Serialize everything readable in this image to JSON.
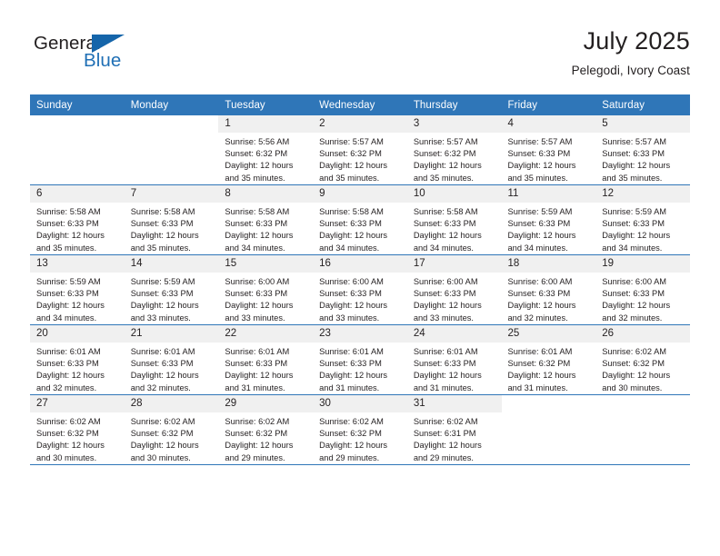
{
  "logo": {
    "word1": "General",
    "word2": "Blue",
    "triangle_color": "#1565aa",
    "blue_text_color": "#1f6fb5"
  },
  "header": {
    "title": "July 2025",
    "subtitle": "Pelegodi, Ivory Coast"
  },
  "theme": {
    "header_blue": "#2f76b8",
    "daynum_strip": "#f0f0f0",
    "text": "#231f20"
  },
  "weekdays": [
    "Sunday",
    "Monday",
    "Tuesday",
    "Wednesday",
    "Thursday",
    "Friday",
    "Saturday"
  ],
  "weeks": [
    [
      {
        "day": "",
        "blank": true
      },
      {
        "day": "",
        "blank": true
      },
      {
        "day": "1",
        "sunrise": "Sunrise: 5:56 AM",
        "sunset": "Sunset: 6:32 PM",
        "daylight1": "Daylight: 12 hours",
        "daylight2": "and 35 minutes."
      },
      {
        "day": "2",
        "sunrise": "Sunrise: 5:57 AM",
        "sunset": "Sunset: 6:32 PM",
        "daylight1": "Daylight: 12 hours",
        "daylight2": "and 35 minutes."
      },
      {
        "day": "3",
        "sunrise": "Sunrise: 5:57 AM",
        "sunset": "Sunset: 6:32 PM",
        "daylight1": "Daylight: 12 hours",
        "daylight2": "and 35 minutes."
      },
      {
        "day": "4",
        "sunrise": "Sunrise: 5:57 AM",
        "sunset": "Sunset: 6:33 PM",
        "daylight1": "Daylight: 12 hours",
        "daylight2": "and 35 minutes."
      },
      {
        "day": "5",
        "sunrise": "Sunrise: 5:57 AM",
        "sunset": "Sunset: 6:33 PM",
        "daylight1": "Daylight: 12 hours",
        "daylight2": "and 35 minutes."
      }
    ],
    [
      {
        "day": "6",
        "sunrise": "Sunrise: 5:58 AM",
        "sunset": "Sunset: 6:33 PM",
        "daylight1": "Daylight: 12 hours",
        "daylight2": "and 35 minutes."
      },
      {
        "day": "7",
        "sunrise": "Sunrise: 5:58 AM",
        "sunset": "Sunset: 6:33 PM",
        "daylight1": "Daylight: 12 hours",
        "daylight2": "and 35 minutes."
      },
      {
        "day": "8",
        "sunrise": "Sunrise: 5:58 AM",
        "sunset": "Sunset: 6:33 PM",
        "daylight1": "Daylight: 12 hours",
        "daylight2": "and 34 minutes."
      },
      {
        "day": "9",
        "sunrise": "Sunrise: 5:58 AM",
        "sunset": "Sunset: 6:33 PM",
        "daylight1": "Daylight: 12 hours",
        "daylight2": "and 34 minutes."
      },
      {
        "day": "10",
        "sunrise": "Sunrise: 5:58 AM",
        "sunset": "Sunset: 6:33 PM",
        "daylight1": "Daylight: 12 hours",
        "daylight2": "and 34 minutes."
      },
      {
        "day": "11",
        "sunrise": "Sunrise: 5:59 AM",
        "sunset": "Sunset: 6:33 PM",
        "daylight1": "Daylight: 12 hours",
        "daylight2": "and 34 minutes."
      },
      {
        "day": "12",
        "sunrise": "Sunrise: 5:59 AM",
        "sunset": "Sunset: 6:33 PM",
        "daylight1": "Daylight: 12 hours",
        "daylight2": "and 34 minutes."
      }
    ],
    [
      {
        "day": "13",
        "sunrise": "Sunrise: 5:59 AM",
        "sunset": "Sunset: 6:33 PM",
        "daylight1": "Daylight: 12 hours",
        "daylight2": "and 34 minutes."
      },
      {
        "day": "14",
        "sunrise": "Sunrise: 5:59 AM",
        "sunset": "Sunset: 6:33 PM",
        "daylight1": "Daylight: 12 hours",
        "daylight2": "and 33 minutes."
      },
      {
        "day": "15",
        "sunrise": "Sunrise: 6:00 AM",
        "sunset": "Sunset: 6:33 PM",
        "daylight1": "Daylight: 12 hours",
        "daylight2": "and 33 minutes."
      },
      {
        "day": "16",
        "sunrise": "Sunrise: 6:00 AM",
        "sunset": "Sunset: 6:33 PM",
        "daylight1": "Daylight: 12 hours",
        "daylight2": "and 33 minutes."
      },
      {
        "day": "17",
        "sunrise": "Sunrise: 6:00 AM",
        "sunset": "Sunset: 6:33 PM",
        "daylight1": "Daylight: 12 hours",
        "daylight2": "and 33 minutes."
      },
      {
        "day": "18",
        "sunrise": "Sunrise: 6:00 AM",
        "sunset": "Sunset: 6:33 PM",
        "daylight1": "Daylight: 12 hours",
        "daylight2": "and 32 minutes."
      },
      {
        "day": "19",
        "sunrise": "Sunrise: 6:00 AM",
        "sunset": "Sunset: 6:33 PM",
        "daylight1": "Daylight: 12 hours",
        "daylight2": "and 32 minutes."
      }
    ],
    [
      {
        "day": "20",
        "sunrise": "Sunrise: 6:01 AM",
        "sunset": "Sunset: 6:33 PM",
        "daylight1": "Daylight: 12 hours",
        "daylight2": "and 32 minutes."
      },
      {
        "day": "21",
        "sunrise": "Sunrise: 6:01 AM",
        "sunset": "Sunset: 6:33 PM",
        "daylight1": "Daylight: 12 hours",
        "daylight2": "and 32 minutes."
      },
      {
        "day": "22",
        "sunrise": "Sunrise: 6:01 AM",
        "sunset": "Sunset: 6:33 PM",
        "daylight1": "Daylight: 12 hours",
        "daylight2": "and 31 minutes."
      },
      {
        "day": "23",
        "sunrise": "Sunrise: 6:01 AM",
        "sunset": "Sunset: 6:33 PM",
        "daylight1": "Daylight: 12 hours",
        "daylight2": "and 31 minutes."
      },
      {
        "day": "24",
        "sunrise": "Sunrise: 6:01 AM",
        "sunset": "Sunset: 6:33 PM",
        "daylight1": "Daylight: 12 hours",
        "daylight2": "and 31 minutes."
      },
      {
        "day": "25",
        "sunrise": "Sunrise: 6:01 AM",
        "sunset": "Sunset: 6:32 PM",
        "daylight1": "Daylight: 12 hours",
        "daylight2": "and 31 minutes."
      },
      {
        "day": "26",
        "sunrise": "Sunrise: 6:02 AM",
        "sunset": "Sunset: 6:32 PM",
        "daylight1": "Daylight: 12 hours",
        "daylight2": "and 30 minutes."
      }
    ],
    [
      {
        "day": "27",
        "sunrise": "Sunrise: 6:02 AM",
        "sunset": "Sunset: 6:32 PM",
        "daylight1": "Daylight: 12 hours",
        "daylight2": "and 30 minutes."
      },
      {
        "day": "28",
        "sunrise": "Sunrise: 6:02 AM",
        "sunset": "Sunset: 6:32 PM",
        "daylight1": "Daylight: 12 hours",
        "daylight2": "and 30 minutes."
      },
      {
        "day": "29",
        "sunrise": "Sunrise: 6:02 AM",
        "sunset": "Sunset: 6:32 PM",
        "daylight1": "Daylight: 12 hours",
        "daylight2": "and 29 minutes."
      },
      {
        "day": "30",
        "sunrise": "Sunrise: 6:02 AM",
        "sunset": "Sunset: 6:32 PM",
        "daylight1": "Daylight: 12 hours",
        "daylight2": "and 29 minutes."
      },
      {
        "day": "31",
        "sunrise": "Sunrise: 6:02 AM",
        "sunset": "Sunset: 6:31 PM",
        "daylight1": "Daylight: 12 hours",
        "daylight2": "and 29 minutes."
      },
      {
        "day": "",
        "blank": true
      },
      {
        "day": "",
        "blank": true
      }
    ]
  ]
}
